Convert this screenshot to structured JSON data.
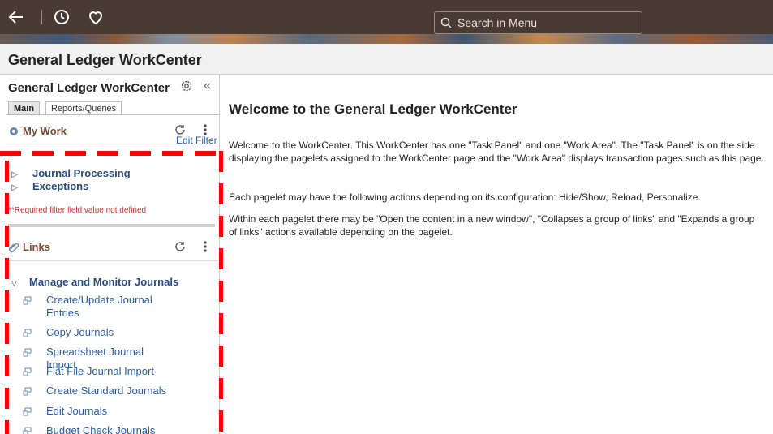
{
  "topbar": {
    "search_placeholder": "Search in Menu"
  },
  "page": {
    "title": "General Ledger WorkCenter"
  },
  "panel": {
    "title": "General Ledger WorkCenter",
    "collapse_glyph": "«",
    "tabs": [
      {
        "label": "Main"
      },
      {
        "label": "Reports/Queries"
      }
    ]
  },
  "my_work": {
    "title": "My Work",
    "edit_filter": "Edit Filter",
    "items": [
      {
        "label": "Journal Processing"
      },
      {
        "label": "Exceptions"
      }
    ],
    "error": "**Required filter field value not defined"
  },
  "links": {
    "title": "Links",
    "section": "Manage and Monitor Journals",
    "items": [
      {
        "label": "Create/Update Journal Entries"
      },
      {
        "label": "Copy Journals"
      },
      {
        "label": "Spreadsheet Journal Import"
      },
      {
        "label": "Flat File Journal Import"
      },
      {
        "label": "Create Standard Journals"
      },
      {
        "label": "Edit Journals"
      },
      {
        "label": "Budget Check Journals"
      }
    ]
  },
  "work_area": {
    "heading": "Welcome to the General Ledger WorkCenter",
    "paragraphs": [
      "Welcome to the WorkCenter. This WorkCenter has one \"Task Panel\" and one \"Work Area\". The \"Task Panel\" is on the side displaying the pagelets assigned to the WorkCenter page and the \"Work Area\" displays transaction pages such as this page.",
      "Each pagelet may have the following actions depending on its configuration: Hide/Show, Reload, Personalize.",
      "Within each pagelet there may be \"Open the content in a new window\", \"Collapses a group of links\" and \"Expands a group of links\" actions available depending on the pagelet."
    ]
  },
  "icons": {
    "back": "back-arrow-icon",
    "recent": "clock-icon",
    "favorites": "heart-icon",
    "search": "search-icon",
    "settings": "gear-icon",
    "refresh": "refresh-icon",
    "menu": "kebab-icon"
  },
  "colors": {
    "topbar": "#4a3a34",
    "pagelet_title": "#7a4a32",
    "link": "#2a5ea0",
    "error": "#d9302a",
    "highlight": "#ff0000"
  }
}
